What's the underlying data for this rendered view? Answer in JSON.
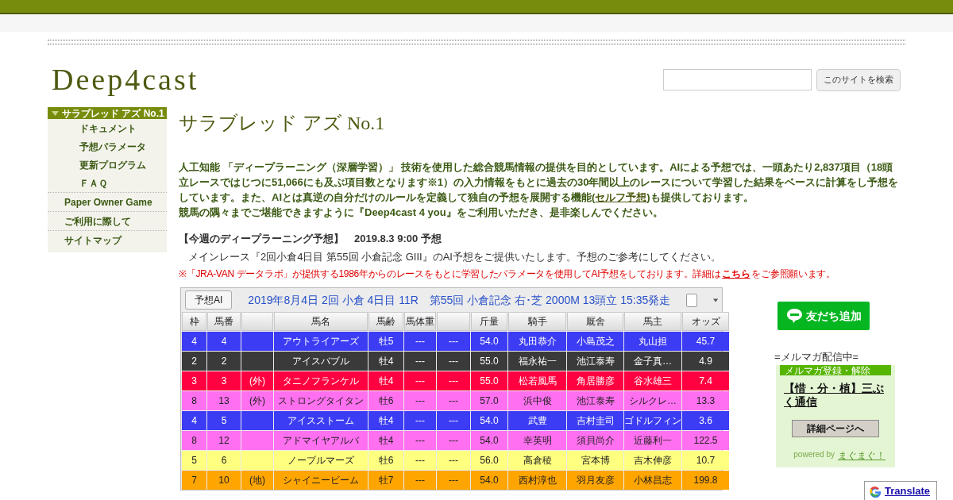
{
  "site_title": "Deep4cast",
  "search": {
    "button": "このサイトを検索"
  },
  "sidebar": [
    {
      "label": "サラブレッド アズ No.1",
      "selected": true,
      "children": [
        {
          "label": "ドキュメント"
        },
        {
          "label": "予想パラメータ"
        },
        {
          "label": "更新プログラム"
        },
        {
          "label": "ＦＡＱ"
        }
      ]
    },
    {
      "label": "Paper Owner Game",
      "selected": false
    },
    {
      "label": "ご利用に際して",
      "selected": false
    },
    {
      "label": "サイトマップ",
      "selected": false
    }
  ],
  "page_title": "サラブレッド アズ No.1",
  "intro": {
    "before": "人工知能 「ディープラーニング（深層学習）」 技術を使用した総合競馬情報の提供を目的としています。AIによる予想では、一頭あたり2,837項目（18頭立レースではじつに51,066にも及ぶ項目数となります※1）の入力情報をもとに過去の30年間以上のレースについて学習した結果をベースに計算をし予想をしています。また、AIとは真逆の自分だけのルールを定義して独自の予想を展開する機能(",
    "link": "セルフ予想",
    "after": ")も提供しております。",
    "line2": "競馬の隅々までご堪能できますように『Deep4cast 4 you』をご利用いただき、是非楽しんでください。"
  },
  "weekly": {
    "heading": "【今週のディープラーニング予想】　2019.8.3 9:00 予想",
    "text": "メインレース『2回小倉4日目 第55回 小倉記念 GIII』のAI予想をご提供いたします。予想のご参考にしてください。",
    "note_before": "※「JRA-VAN データラボ」が提供する1986年からのレースをもとに学習したパラメータを使用してAI予想をしております。詳細は",
    "note_link": "こちら",
    "note_after": "をご参照願います。"
  },
  "race_panel": {
    "button": "予想AI",
    "race_info": "2019年8月4日 2回 小倉 4日目 11R　第55回 小倉記念  右･芝 2000M  13頭立  15:35発走",
    "checked": false,
    "columns": [
      "枠",
      "馬番",
      "",
      "馬名",
      "馬齢",
      "馬体重",
      "",
      "斤量",
      "騎手",
      "厩舎",
      "馬主",
      "オッズ"
    ],
    "rows": [
      {
        "color": "#3c3cf5",
        "cells": [
          "4",
          "4",
          "",
          "アウトライアーズ",
          "牡5",
          "---",
          "---",
          "54.0",
          "丸田恭介",
          "小島茂之",
          "丸山担",
          "45.7"
        ]
      },
      {
        "color": "#3a3a3a",
        "cells": [
          "2",
          "2",
          "",
          "アイスバブル",
          "牡4",
          "---",
          "---",
          "55.0",
          "福永祐一",
          "池江泰寿",
          "金子真…",
          "4.9"
        ]
      },
      {
        "color": "#ff0040",
        "cells": [
          "3",
          "3",
          "(外)",
          "タニノフランケル",
          "牡4",
          "---",
          "---",
          "55.0",
          "松若風馬",
          "角居勝彦",
          "谷水雄三",
          "7.4"
        ]
      },
      {
        "color": "#ff70f0",
        "cells": [
          "8",
          "13",
          "(外)",
          "ストロングタイタン",
          "牡6",
          "---",
          "---",
          "57.0",
          "浜中俊",
          "池江泰寿",
          "シルクレ…",
          "13.3"
        ]
      },
      {
        "color": "#3c3cf5",
        "cells": [
          "4",
          "5",
          "",
          "アイスストーム",
          "牡4",
          "---",
          "---",
          "54.0",
          "武豊",
          "吉村圭司",
          "ゴドルフィン",
          "3.6"
        ]
      },
      {
        "color": "#ff70f0",
        "cells": [
          "8",
          "12",
          "",
          "アドマイヤアルバ",
          "牡4",
          "---",
          "---",
          "54.0",
          "幸英明",
          "須貝尚介",
          "近藤利一",
          "122.5"
        ]
      },
      {
        "color": "#ffff80",
        "cells": [
          "5",
          "6",
          "",
          "ノーブルマーズ",
          "牡6",
          "---",
          "---",
          "56.0",
          "高倉稜",
          "宮本博",
          "吉木伸彦",
          "10.7"
        ]
      },
      {
        "color": "#ffa500",
        "cells": [
          "7",
          "10",
          "(地)",
          "シャイニービーム",
          "牡7",
          "---",
          "---",
          "54.0",
          "西村淳也",
          "羽月友彦",
          "小林昌志",
          "199.8"
        ]
      }
    ]
  },
  "line_button": "友だち追加",
  "mailmag": {
    "caption": "=メルマガ配信中=",
    "header": "メルマガ登録・解除",
    "title": "【惜・分・植】三ぶく通信",
    "button": "詳細ページへ",
    "powered": "powered by",
    "powered_link": "まぐまぐ！"
  },
  "translate": "Translate"
}
